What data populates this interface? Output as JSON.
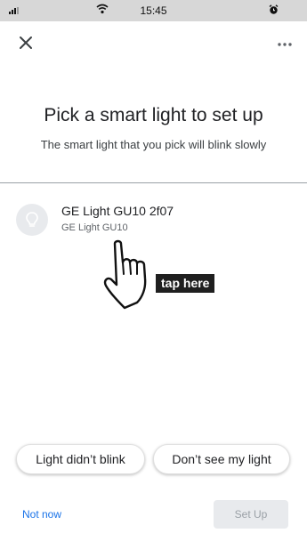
{
  "status_bar": {
    "time": "15:45",
    "icons": [
      "signal-icon",
      "wifi-icon",
      "alarm-icon"
    ]
  },
  "header": {
    "close_icon": "close-icon",
    "more_icon": "more-horiz-icon"
  },
  "main": {
    "title": "Pick a smart light to set up",
    "subtitle": "The smart light that you pick will blink slowly",
    "devices": [
      {
        "name": "GE Light GU10 2f07",
        "model": "GE Light GU10",
        "icon": "lightbulb-icon"
      }
    ],
    "annotation": {
      "label": "tap here",
      "icon": "pointing-hand-icon"
    }
  },
  "actions": {
    "chip_blink": "Light didn’t blink",
    "chip_missing": "Don’t see my light",
    "not_now": "Not now",
    "set_up": "Set Up"
  },
  "colors": {
    "accent": "#1a73e8",
    "status_bar_bg": "#d7d7d7",
    "disabled_bg": "#e8eaed",
    "disabled_text": "#9aa0a6"
  }
}
